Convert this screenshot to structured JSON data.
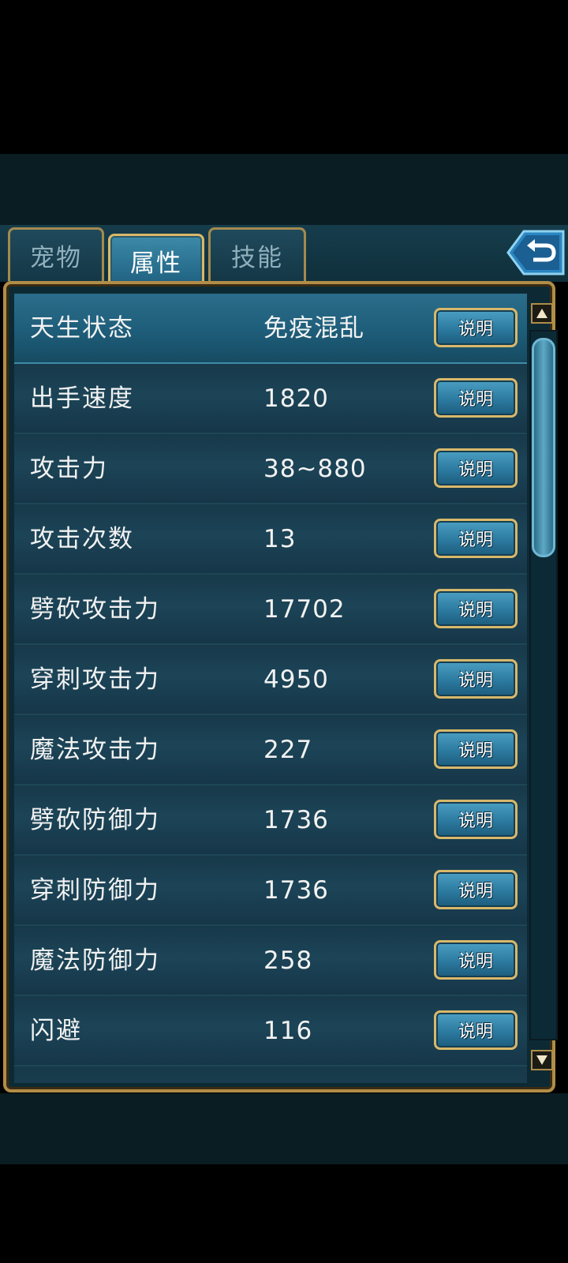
{
  "tabs": [
    {
      "label": "宠物"
    },
    {
      "label": "属性"
    },
    {
      "label": "技能"
    }
  ],
  "active_tab": "属性",
  "info_button_label": "说明",
  "attributes": [
    {
      "name": "天生状态",
      "value": "免疫混乱"
    },
    {
      "name": "出手速度",
      "value": "1820"
    },
    {
      "name": "攻击力",
      "value": "38~880"
    },
    {
      "name": "攻击次数",
      "value": "13"
    },
    {
      "name": "劈砍攻击力",
      "value": "17702"
    },
    {
      "name": "穿刺攻击力",
      "value": "4950"
    },
    {
      "name": "魔法攻击力",
      "value": "227"
    },
    {
      "name": "劈砍防御力",
      "value": "1736"
    },
    {
      "name": "穿刺防御力",
      "value": "1736"
    },
    {
      "name": "魔法防御力",
      "value": "258"
    },
    {
      "name": "闪避",
      "value": "116"
    }
  ],
  "colors": {
    "frame_gold": "#d8b86b",
    "panel_bg": "#0d2a34",
    "selected_row": "#2b6d8a",
    "button_blue": "#2c7aa0"
  },
  "icons": {
    "back": "back-arrow-icon",
    "scroll_up": "triangle-up-icon",
    "scroll_down": "triangle-down-icon"
  }
}
